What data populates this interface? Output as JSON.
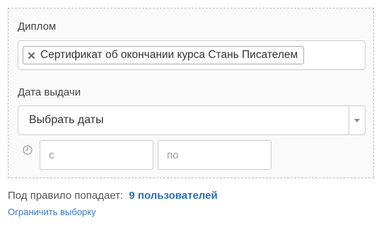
{
  "filter": {
    "diploma": {
      "label": "Диплом",
      "selected_tags": [
        "Сертификат об окончании курса Стань Писателем"
      ]
    },
    "issue_date": {
      "label": "Дата выдачи",
      "select_value": "Выбрать даты",
      "from_placeholder": "с",
      "to_placeholder": "по"
    }
  },
  "summary": {
    "prefix": "Под правило попадает:",
    "count": "9 пользователей",
    "limit_link": "Ограничить выборку"
  },
  "icons": {
    "tag_remove": "close-icon",
    "select_arrow": "caret-down-icon",
    "clock": "clock-icon"
  },
  "colors": {
    "link": "#2f6fb3",
    "panel_border": "#bdbdbd"
  }
}
